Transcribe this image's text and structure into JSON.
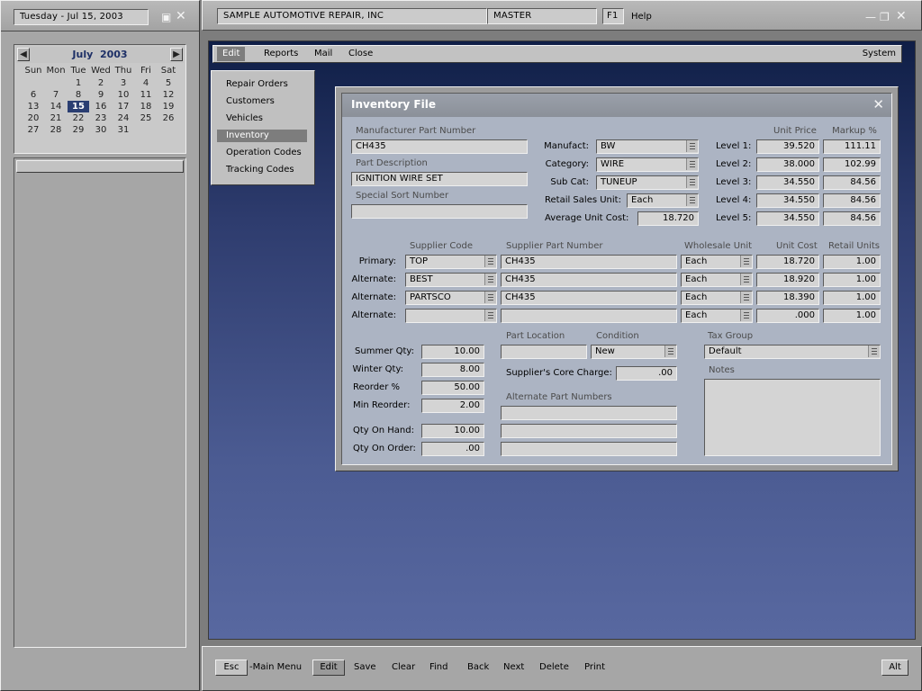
{
  "left_panel": {
    "date_label": "Tuesday - Jul 15, 2003",
    "calendar": {
      "month": "July",
      "year": "2003",
      "days_of_week": [
        "Sun",
        "Mon",
        "Tue",
        "Wed",
        "Thu",
        "Fri",
        "Sat"
      ],
      "weeks": [
        [
          "",
          "",
          "1",
          "2",
          "3",
          "4",
          "5"
        ],
        [
          "6",
          "7",
          "8",
          "9",
          "10",
          "11",
          "12"
        ],
        [
          "13",
          "14",
          "15",
          "16",
          "17",
          "18",
          "19"
        ],
        [
          "20",
          "21",
          "22",
          "23",
          "24",
          "25",
          "26"
        ],
        [
          "27",
          "28",
          "29",
          "30",
          "31",
          "",
          ""
        ]
      ],
      "selected_day": "15"
    }
  },
  "header": {
    "company": "SAMPLE AUTOMOTIVE REPAIR, INC",
    "user": "MASTER",
    "help_key": "F1",
    "help_label": "Help"
  },
  "menu": {
    "items": [
      "Edit",
      "Reports",
      "Mail",
      "Close"
    ],
    "active": "Edit",
    "system_label": "System"
  },
  "side_menu": {
    "items": [
      "Repair Orders",
      "Customers",
      "Vehicles",
      "Inventory",
      "Operation Codes",
      "Tracking Codes"
    ],
    "active": "Inventory"
  },
  "inventory": {
    "title": "Inventory File",
    "labels": {
      "mfr_part_number": "Manufacturer Part Number",
      "part_description": "Part Description",
      "special_sort": "Special Sort Number",
      "manufact": "Manufact:",
      "category": "Category:",
      "sub_cat": "Sub Cat:",
      "retail_sales_unit": "Retail Sales Unit:",
      "avg_unit_cost": "Average Unit Cost:",
      "unit_price": "Unit Price",
      "markup": "Markup %",
      "supplier_code": "Supplier Code",
      "supplier_part_number": "Supplier Part Number",
      "wholesale_unit": "Wholesale Unit",
      "unit_cost": "Unit Cost",
      "retail_units": "Retail Units",
      "summer_qty": "Summer Qty:",
      "winter_qty": "Winter Qty:",
      "reorder_pct": "Reorder %",
      "min_reorder": "Min Reorder:",
      "qty_on_hand": "Qty On Hand:",
      "qty_on_order": "Qty On Order:",
      "part_location": "Part Location",
      "condition": "Condition",
      "core_charge": "Supplier's Core Charge:",
      "alt_part_numbers": "Alternate Part Numbers",
      "tax_group": "Tax Group",
      "notes": "Notes"
    },
    "values": {
      "mfr_part_number": "CH435",
      "part_description": "IGNITION WIRE SET",
      "special_sort": "",
      "manufact": "BW",
      "category": "WIRE",
      "sub_cat": "TUNEUP",
      "retail_sales_unit": "Each",
      "avg_unit_cost": "18.720",
      "summer_qty": "10.00",
      "winter_qty": "8.00",
      "reorder_pct": "50.00",
      "min_reorder": "2.00",
      "qty_on_hand": "10.00",
      "qty_on_order": ".00",
      "part_location": "",
      "condition": "New",
      "core_charge": ".00",
      "alt_part_numbers": [
        "",
        "",
        ""
      ],
      "tax_group": "Default",
      "notes": ""
    },
    "levels": [
      {
        "label": "Level 1:",
        "unit_price": "39.520",
        "markup": "111.11"
      },
      {
        "label": "Level 2:",
        "unit_price": "38.000",
        "markup": "102.99"
      },
      {
        "label": "Level 3:",
        "unit_price": "34.550",
        "markup": "84.56"
      },
      {
        "label": "Level 4:",
        "unit_price": "34.550",
        "markup": "84.56"
      },
      {
        "label": "Level 5:",
        "unit_price": "34.550",
        "markup": "84.56"
      }
    ],
    "suppliers": [
      {
        "label": "Primary:",
        "code": "TOP",
        "part_number": "CH435",
        "unit": "Each",
        "cost": "18.720",
        "retail_units": "1.00"
      },
      {
        "label": "Alternate:",
        "code": "BEST",
        "part_number": "CH435",
        "unit": "Each",
        "cost": "18.920",
        "retail_units": "1.00"
      },
      {
        "label": "Alternate:",
        "code": "PARTSCO",
        "part_number": "CH435",
        "unit": "Each",
        "cost": "18.390",
        "retail_units": "1.00"
      },
      {
        "label": "Alternate:",
        "code": "",
        "part_number": "",
        "unit": "Each",
        "cost": ".000",
        "retail_units": "1.00"
      }
    ]
  },
  "bottom_bar": {
    "esc_key": "Esc",
    "main_menu_label": "-Main Menu",
    "edit_label": "Edit",
    "actions": [
      "Save",
      "Clear",
      "Find",
      "Back",
      "Next",
      "Delete",
      "Print"
    ],
    "alt_label": "Alt"
  },
  "colors": {
    "desktop_top": "#0f1e46",
    "desktop_bottom": "#5868a0",
    "calendar_selected": "#2a3e72"
  }
}
